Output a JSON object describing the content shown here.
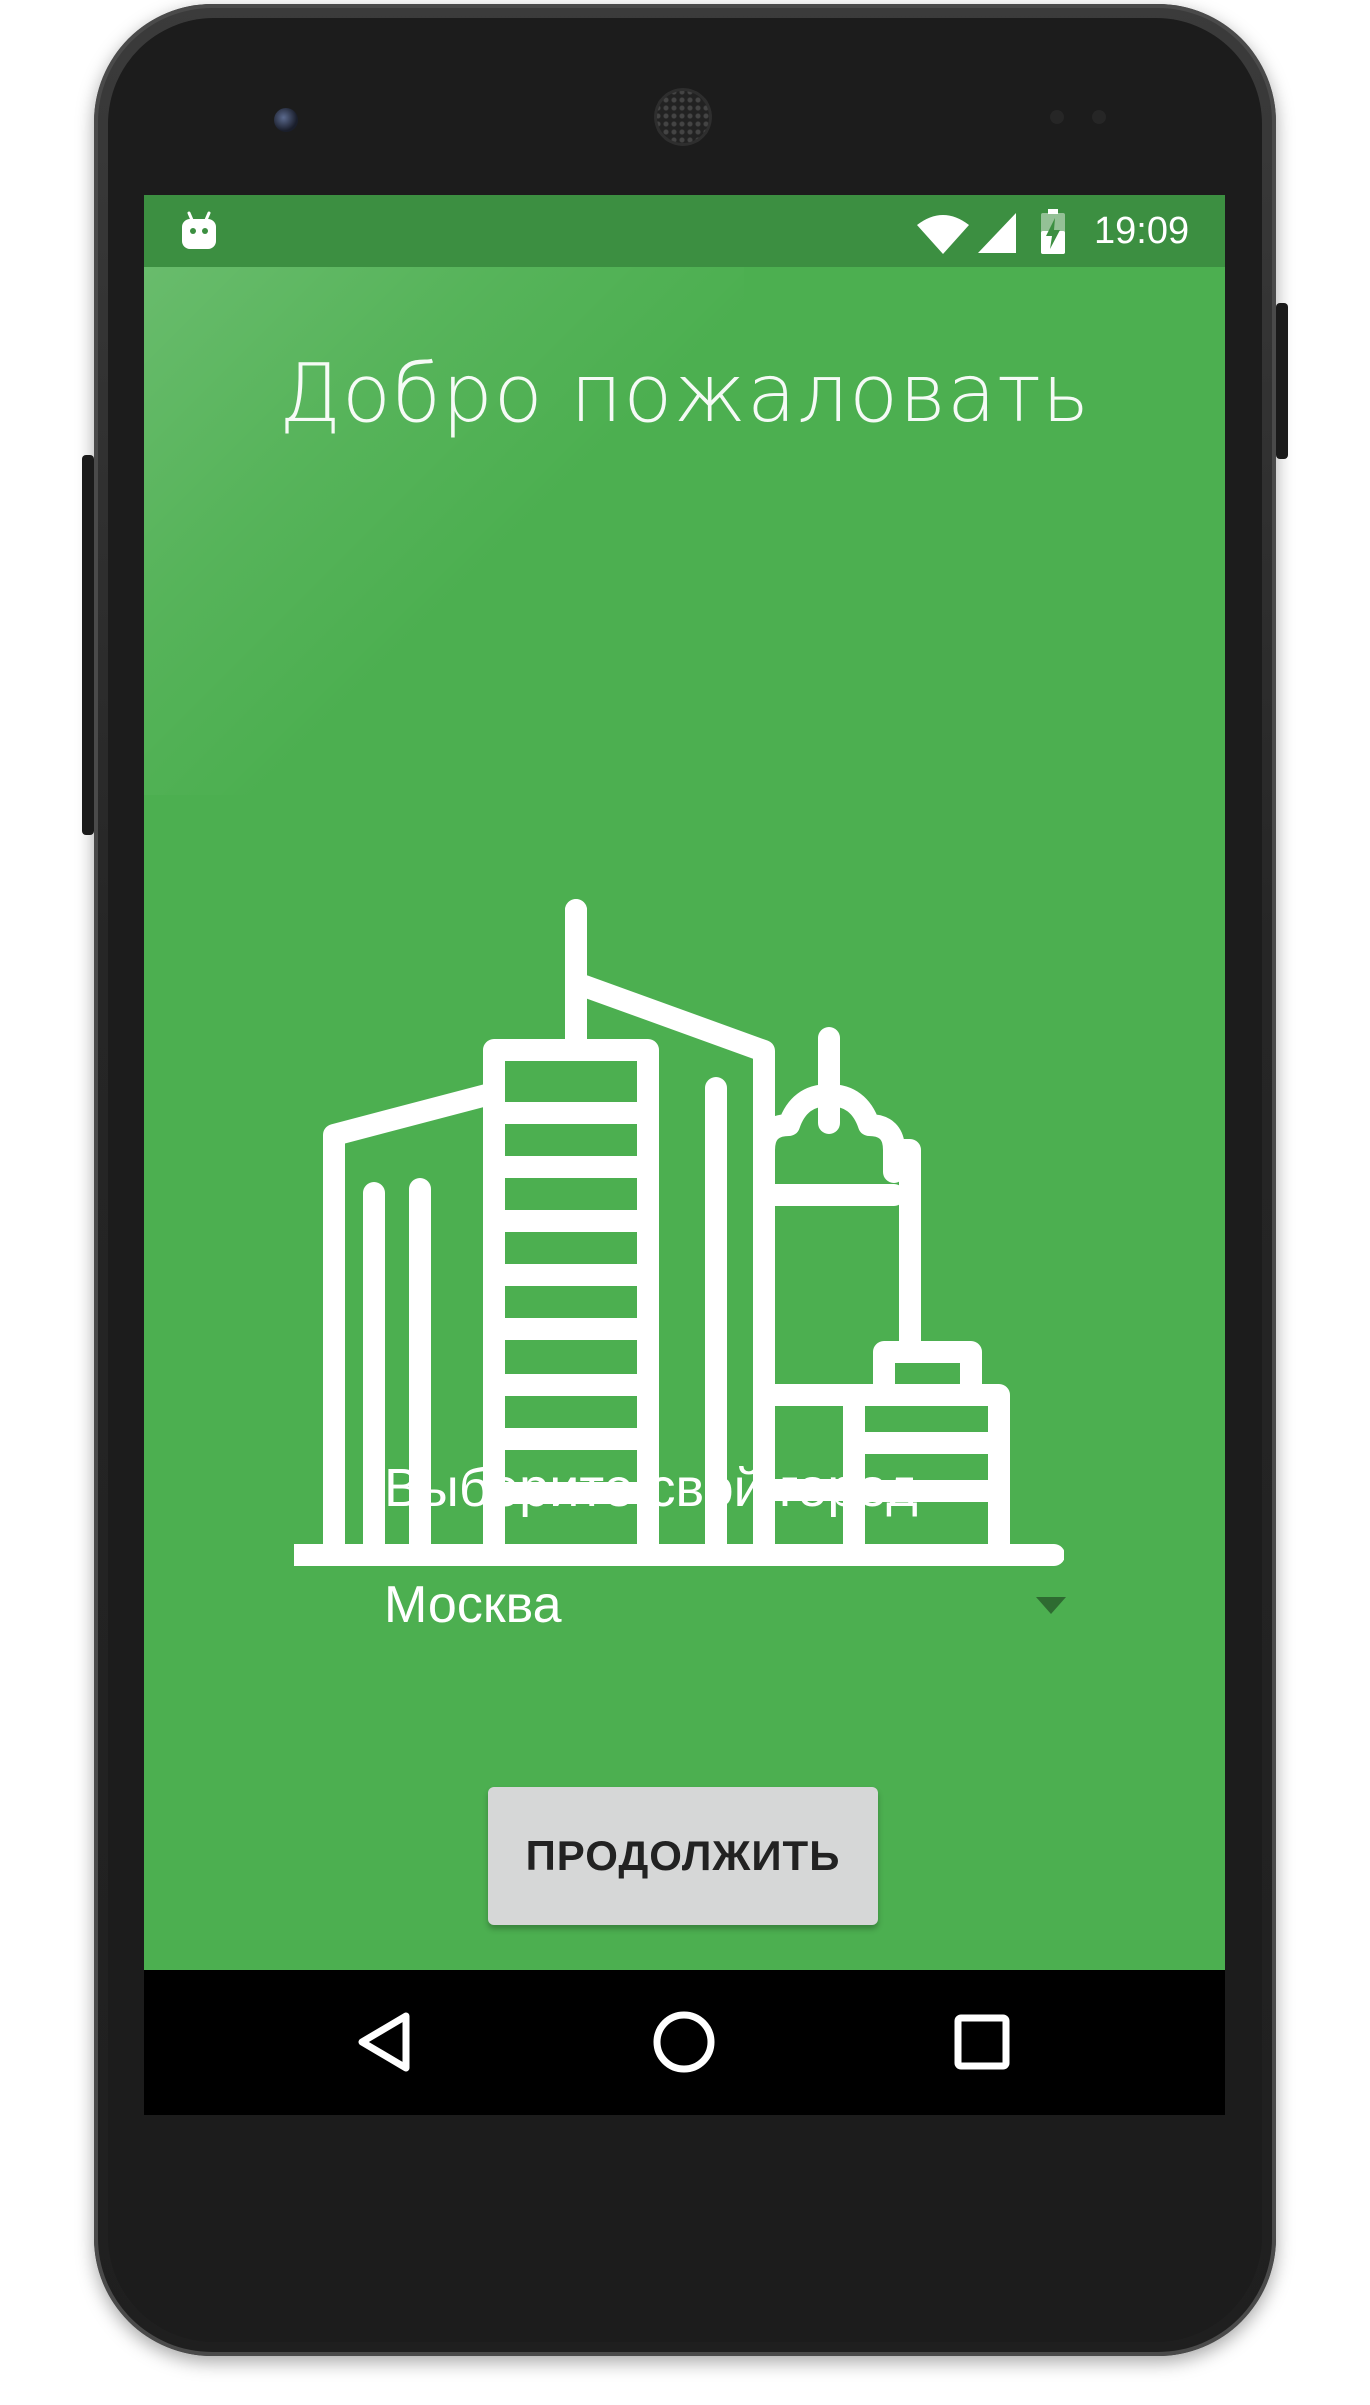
{
  "status_bar": {
    "time": "19:09",
    "icons": [
      "android-robot-icon",
      "wifi-icon",
      "cell-signal-icon",
      "battery-charging-icon"
    ]
  },
  "welcome": {
    "title": "Добро пожаловать"
  },
  "illustration": {
    "icon": "city-buildings-icon"
  },
  "city_picker": {
    "label": "Выберите свой город",
    "selected": "Москва",
    "icon": "dropdown-arrow-icon"
  },
  "actions": {
    "continue_label": "ПРОДОЛЖИТЬ"
  },
  "navigation_bar": {
    "icons": [
      "back-icon",
      "home-icon",
      "recents-icon"
    ]
  },
  "colors": {
    "primary": "#4caf50",
    "status_bar": "#3c8f41",
    "button": "#d6d7d7",
    "nav_bar": "#000000"
  }
}
